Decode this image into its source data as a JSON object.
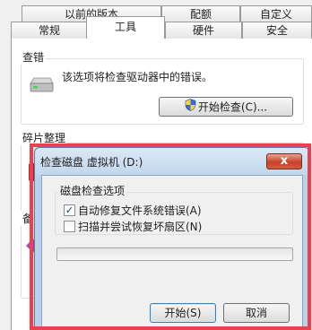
{
  "tabs": {
    "row1": [
      "以前的版本",
      "配额",
      "自定义"
    ],
    "row2": [
      "常规",
      "工具",
      "硬件",
      "安全"
    ]
  },
  "error_checking": {
    "title": "查错",
    "description": "该选项将检查驱动器中的错误。",
    "button": "开始检查(C)..."
  },
  "defrag": {
    "title": "碎片整理"
  },
  "backup": {
    "title_partial": "备"
  },
  "dialog": {
    "title": "检查磁盘 虚拟机 (D:)",
    "close_label": "x",
    "group_title": "磁盘检查选项",
    "option1": {
      "label": "自动修复文件系统错误(A)",
      "checked": true
    },
    "option2": {
      "label": "扫描并尝试恢复坏扇区(N)",
      "checked": false
    },
    "progress": 0,
    "start_button": "开始(S)",
    "cancel_button": "取消"
  },
  "colors": {
    "highlight": "#e8414f"
  }
}
